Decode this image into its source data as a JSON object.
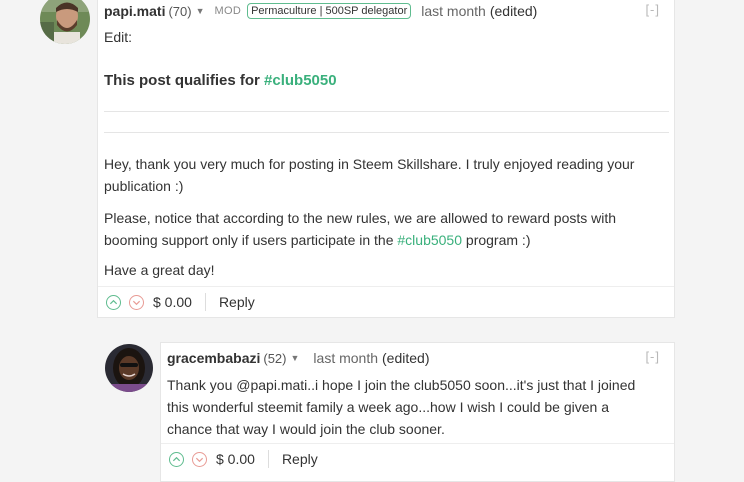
{
  "comment1": {
    "author": "papi.mati",
    "reputation": "(70)",
    "mod_label": "MOD",
    "badge": "Permaculture | 500SP delegator",
    "time": "last month",
    "edited": "(edited)",
    "collapse": "[-]",
    "edit_line": "Edit:",
    "qualifies_text": "This post qualifies for ",
    "qualifies_tag": "#club5050",
    "para1": "Hey, thank you very much for posting in Steem Skillshare. I truly enjoyed reading your publication :)",
    "para2_a": "Please, notice that according to the new rules, we are allowed to reward posts with booming support only if users participate in the ",
    "para2_tag": "#club5050",
    "para2_b": " program :)",
    "para3": "Have a great day!",
    "payout": "$ 0.00",
    "reply": "Reply"
  },
  "comment2": {
    "author": "gracembabazi",
    "reputation": "(52)",
    "time": "last month",
    "edited": "(edited)",
    "collapse": "[-]",
    "para1": "Thank you @papi.mati..i hope I join the club5050 soon...it's just that I joined this wonderful steemit family a week ago...how I wish I could be given a chance that way I would join the club sooner.",
    "payout": "$ 0.00",
    "reply": "Reply"
  },
  "colors": {
    "accent": "#3ab07c",
    "upvote": "#5fbc8f",
    "downvote": "#e89b95"
  },
  "icons": [
    "caret-down-icon",
    "upvote-icon",
    "downvote-icon"
  ]
}
